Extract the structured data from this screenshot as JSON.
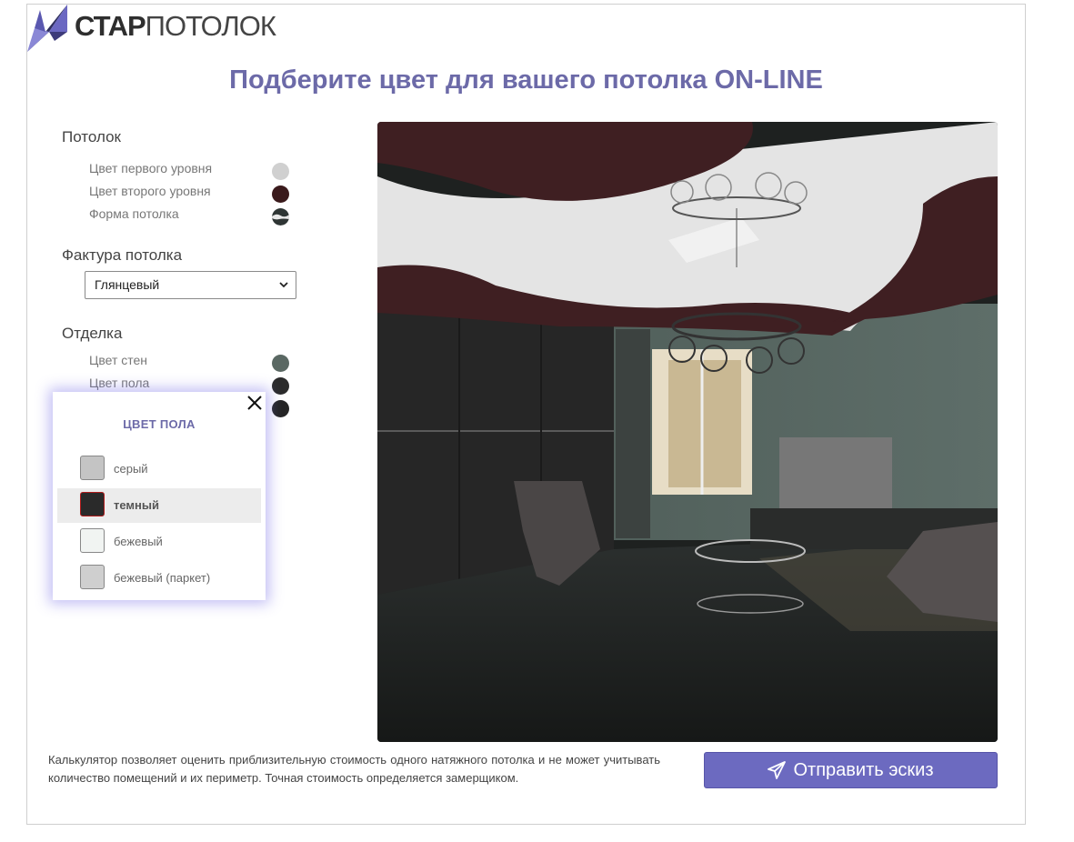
{
  "logo": {
    "brand_bold": "СТАР",
    "brand_light": "ПОТОЛОК"
  },
  "title": "Подберите цвет для вашего потолка ON-LINE",
  "ceiling": {
    "heading": "Потолок",
    "options": [
      {
        "label": "Цвет первого уровня",
        "color": "#d0d0d0"
      },
      {
        "label": "Цвет второго уровня",
        "color": "#3a1a1c"
      },
      {
        "label": "Форма потолка",
        "color": "#2e3534"
      }
    ]
  },
  "texture": {
    "heading": "Фактура потолка",
    "value": "Глянцевый"
  },
  "finish": {
    "heading": "Отделка",
    "options": [
      {
        "label": "Цвет стен",
        "color": "#5a6863"
      },
      {
        "label": "Цвет пола",
        "color": "#2b2b2b"
      },
      {
        "label": "",
        "color": "#252525"
      }
    ]
  },
  "popup": {
    "title": "ЦВЕТ ПОЛА",
    "items": [
      {
        "label": "серый",
        "color": "#c4c4c4",
        "active": false
      },
      {
        "label": "темный",
        "color": "#2a2a2a",
        "active": true
      },
      {
        "label": "бежевый",
        "color": "#f1f4f2",
        "active": false
      },
      {
        "label": "бежевый (паркет)",
        "color": "#cfcfcf",
        "active": false
      }
    ]
  },
  "footer": {
    "note": "Калькулятор позволяет оценить приблизительную стоимость одного натяжного потолка и не может учитывать количество помещений и их периметр. Точная стоимость определяется замерщиком.",
    "send_button": "Отправить эскиз"
  },
  "colors": {
    "accent": "#6c6ac0",
    "title": "#6c6aa8"
  }
}
